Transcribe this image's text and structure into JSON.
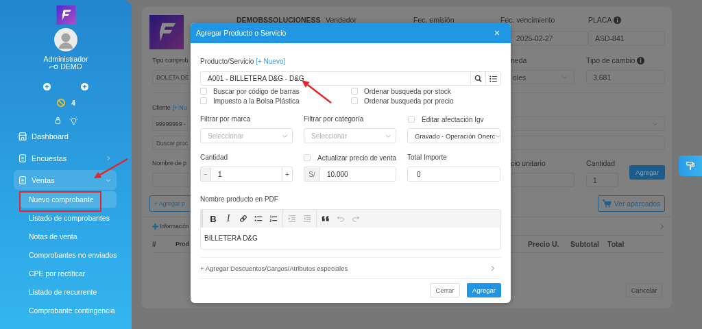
{
  "sidebar": {
    "user_name": "Administrador",
    "user_role": "DEMO",
    "alert_count": "4",
    "menu": [
      {
        "kind": "link",
        "label": "Dashboard"
      },
      {
        "kind": "group",
        "label": "Encuestas",
        "expanded": false
      },
      {
        "kind": "group",
        "label": "Ventas",
        "expanded": true,
        "children": [
          {
            "label": "Nuevo comprobante",
            "selected": true
          },
          {
            "label": "Listado de comprobantes",
            "selected": false
          },
          {
            "label": "Notas de venta",
            "selected": false
          },
          {
            "label": "Comprobantes no enviados",
            "selected": false
          },
          {
            "label": "CPE por rectificar",
            "selected": false
          },
          {
            "label": "Listado de recurrente",
            "selected": false
          },
          {
            "label": "Comprobante contingencia",
            "selected": false
          }
        ]
      }
    ]
  },
  "form": {
    "company": "DEMOBSSOLUCIONESS",
    "seller_label": "Vendedor",
    "issue_date_label": "Fec. emisión",
    "due_date_label": "Fec. vencimiento",
    "due_date": "2025-02-27",
    "plate_label": "PLACA",
    "plate": "ASD-841",
    "doc_type_label": "Tipo comprob",
    "doc_type": "BOLETA DE",
    "currency_label": "neda",
    "currency": "oles",
    "exchange_label": "Tipo de cambio",
    "exchange_rate": "3.681",
    "client_label": "Cliente",
    "client_link": "[+ Nu",
    "client": "99999999 -",
    "product_search_placeholder": "Buscar proc",
    "product_name_label": "Nombre de p",
    "unit_price_label": "cio unitario",
    "quantity_label": "Cantidad",
    "quantity": "1",
    "add_button": "Agregar",
    "add_product_button": "+ Agregar p",
    "parked_button": "Ver aparcados",
    "info_toggle": "Información",
    "columns": [
      "#",
      "Prod",
      "Precio U.",
      "Subtotal",
      "Total"
    ],
    "cancel_button": "Cancelar"
  },
  "modal": {
    "title": "Agregar Producto o Servicio",
    "product_label": "Producto/Servicio",
    "new_link": "[+ Nuevo]",
    "product_value": "A001 - BILLETERA D&G - D&G",
    "options": [
      {
        "label": "Buscar por código de barras",
        "checked": false
      },
      {
        "label": "Ordenar busqueda por stock",
        "checked": false
      },
      {
        "label": "Impuesto a la Bolsa Plástica",
        "checked": false
      },
      {
        "label": "Ordenar busqueda por precio",
        "checked": false
      }
    ],
    "brand_filter": {
      "label": "Filtrar por marca",
      "placeholder": "Seleccionar"
    },
    "category_filter": {
      "label": "Filtrar por categoría",
      "placeholder": "Seleccionar"
    },
    "igv": {
      "label": "Editar afectación Igv",
      "checked": false,
      "value": "Gravado - Operación Onerc"
    },
    "quantity": {
      "label": "Cantidad",
      "value": "1",
      "minus": "−",
      "plus": "+"
    },
    "price": {
      "label": "Actualizar precio de venta",
      "checked": false,
      "currency": "S/",
      "value": "10.000"
    },
    "total": {
      "label": "Total Importe",
      "value": "0"
    },
    "pdf_name": {
      "label": "Nombre producto en PDF",
      "value": "BILLETERA D&G"
    },
    "toolbar": [
      {
        "kind": "bold",
        "glyph": "B",
        "disabled": false
      },
      {
        "kind": "italic",
        "glyph": "I",
        "disabled": false
      },
      {
        "kind": "link",
        "disabled": false
      },
      {
        "kind": "bullets",
        "disabled": false
      },
      {
        "kind": "numbers",
        "disabled": false
      },
      {
        "kind": "outdent",
        "disabled": true
      },
      {
        "kind": "indent",
        "disabled": true
      },
      {
        "kind": "quote",
        "disabled": false
      },
      {
        "kind": "undo",
        "disabled": true
      },
      {
        "kind": "redo",
        "disabled": true
      }
    ],
    "extras": "+ Agregar Descuentos/Cargos/Atributos especiales",
    "buttons": [
      {
        "label": "Cerrar",
        "kind": "secondary"
      },
      {
        "label": "Agregar",
        "kind": "primary"
      }
    ]
  },
  "annotations": [
    {
      "kind": "arrow"
    },
    {
      "kind": "box"
    },
    {
      "kind": "arrow"
    }
  ]
}
